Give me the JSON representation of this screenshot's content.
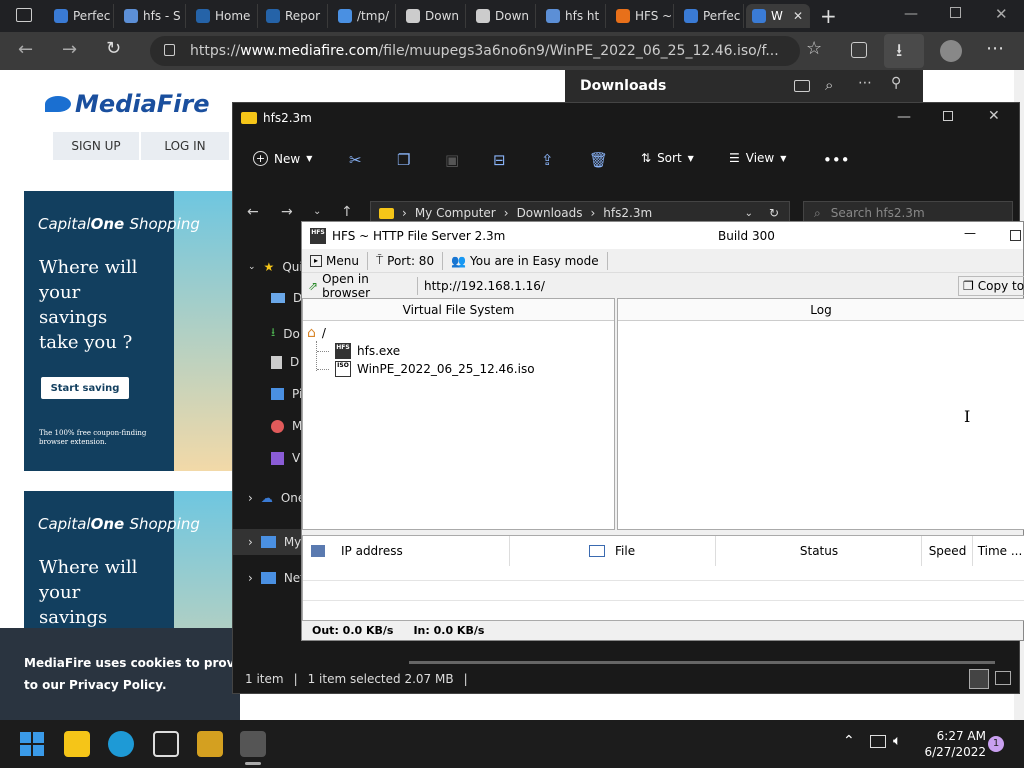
{
  "browser": {
    "tabs": [
      {
        "label": "Perfec",
        "color": "#3a7bd5"
      },
      {
        "label": "hfs - S",
        "color": "#5c8fd6"
      },
      {
        "label": "Home",
        "color": "#2563a8"
      },
      {
        "label": "Repor",
        "color": "#2563a8"
      },
      {
        "label": "/tmp/",
        "color": "#4a90e2"
      },
      {
        "label": "Down",
        "color": "#cccccc"
      },
      {
        "label": "Down",
        "color": "#cccccc"
      },
      {
        "label": "hfs ht",
        "color": "#5c8fd6"
      },
      {
        "label": "HFS ~",
        "color": "#e8701a"
      },
      {
        "label": "Perfec",
        "color": "#3a7bd5"
      },
      {
        "label": "W",
        "color": "#3a7bd5"
      }
    ],
    "url_prefix": "https://",
    "url_domain": "www.mediafire.com",
    "url_rest": "/file/muupegs3a6no6n9/WinPE_2022_06_25_12.46.iso/f..."
  },
  "mediafire": {
    "logo": "MediaFire",
    "signup": "SIGN UP",
    "login": "LOG IN",
    "ads": [
      {
        "brand": "Capital",
        "brand2": "One",
        "brand3": "Shopping",
        "text1": "Where will",
        "text2": "your",
        "text3": "savings",
        "text4": "take you  ?",
        "button": "Start saving",
        "small1": "The 100% free coupon-finding",
        "small2": "browser extension."
      },
      {
        "brand": "Capital",
        "brand2": "One",
        "brand3": "Shopping",
        "text1": "Where will",
        "text2": "your",
        "text3": "savings"
      }
    ],
    "cookie_line1": "MediaFire uses cookies to provide y",
    "cookie_line2": "to our Privacy Policy."
  },
  "downloads": {
    "title": "Downloads"
  },
  "explorer": {
    "title": "hfs2.3m",
    "new": "New",
    "sort": "Sort",
    "view": "View",
    "crumbs": [
      "My Computer",
      "Downloads",
      "hfs2.3m"
    ],
    "search_placeholder": "Search hfs2.3m",
    "nav": [
      {
        "label": "Qui",
        "color": "#f5c518"
      },
      {
        "label": "D",
        "color": "#6aa7e8"
      },
      {
        "label": "Do",
        "color": "#4caf50"
      },
      {
        "label": "D",
        "color": "#cccccc"
      },
      {
        "label": "Pi",
        "color": "#4a90e2"
      },
      {
        "label": "M",
        "color": "#e05a5a"
      },
      {
        "label": "Vi",
        "color": "#8a5cd6"
      },
      {
        "label": "One",
        "color": "#3a7bd5"
      },
      {
        "label": "My",
        "color": "#4a90e2"
      },
      {
        "label": "Net",
        "color": "#4a90e2"
      }
    ],
    "status_items": "1 item",
    "status_selected": "1 item selected  2.07 MB"
  },
  "hfs": {
    "title": "HFS ~ HTTP File Server 2.3m",
    "build": "Build 300",
    "menu": "Menu",
    "port": "Port: 80",
    "mode": "You are in Easy mode",
    "open_in_browser": "Open in browser",
    "url": "http://192.168.1.16/",
    "copy": "Copy to",
    "vfs_header": "Virtual File System",
    "log_header": "Log",
    "root": "/",
    "files": [
      {
        "name": "hfs.exe",
        "icon": "HFS"
      },
      {
        "name": "WinPE_2022_06_25_12.46.iso",
        "icon": "ISO"
      }
    ],
    "columns": [
      "IP address",
      "File",
      "Status",
      "Speed",
      "Time ..."
    ],
    "out": "Out: 0.0 KB/s",
    "in": "In: 0.0 KB/s"
  },
  "taskbar": {
    "time": "6:27 AM",
    "date": "6/27/2022",
    "badge": "1"
  }
}
